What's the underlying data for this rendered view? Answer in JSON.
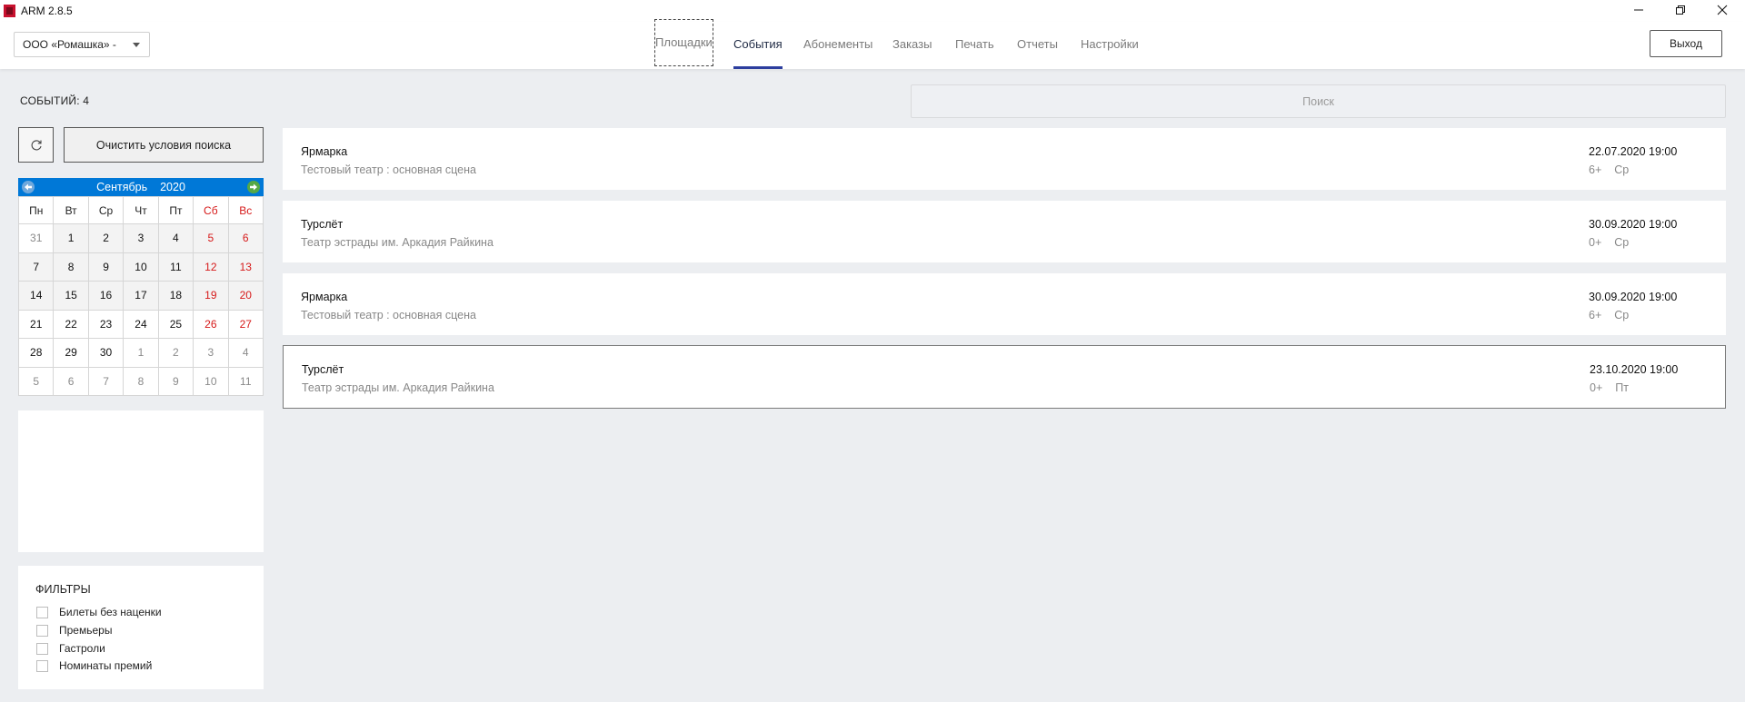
{
  "window": {
    "title": "ARM 2.8.5"
  },
  "header": {
    "organization": "ООО «Ромашка» -",
    "tabs": [
      {
        "label": "Площадки"
      },
      {
        "label": "События"
      },
      {
        "label": "Абонементы"
      },
      {
        "label": "Заказы"
      },
      {
        "label": "Печать"
      },
      {
        "label": "Отчеты"
      },
      {
        "label": "Настройки"
      }
    ],
    "active_tab": "События",
    "logout_label": "Выход"
  },
  "events_count": {
    "label": "СОБЫТИЙ:",
    "value": "4"
  },
  "search": {
    "placeholder": "Поиск"
  },
  "controls": {
    "clear_label": "Очистить условия поиска"
  },
  "calendar": {
    "month": "Сентябрь",
    "year": "2020",
    "weekdays": [
      "Пн",
      "Вт",
      "Ср",
      "Чт",
      "Пт",
      "Сб",
      "Вс"
    ],
    "weeks": [
      [
        "31",
        "1",
        "2",
        "3",
        "4",
        "5",
        "6"
      ],
      [
        "7",
        "8",
        "9",
        "10",
        "11",
        "12",
        "13"
      ],
      [
        "14",
        "15",
        "16",
        "17",
        "18",
        "19",
        "20"
      ],
      [
        "21",
        "22",
        "23",
        "24",
        "25",
        "26",
        "27"
      ],
      [
        "28",
        "29",
        "30",
        "1",
        "2",
        "3",
        "4"
      ],
      [
        "5",
        "6",
        "7",
        "8",
        "9",
        "10",
        "11"
      ]
    ]
  },
  "filters": {
    "title": "ФИЛЬТРЫ",
    "items": [
      {
        "label": "Билеты без наценки",
        "checked": false
      },
      {
        "label": "Премьеры",
        "checked": false
      },
      {
        "label": "Гастроли",
        "checked": false
      },
      {
        "label": "Номинаты премий",
        "checked": false
      }
    ]
  },
  "events": [
    {
      "title": "Ярмарка",
      "venue": "Тестовый театр : основная сцена",
      "datetime": "22.07.2020 19:00",
      "age": "6+",
      "weekday": "Ср"
    },
    {
      "title": "Турслёт",
      "venue": "Театр эстрады им. Аркадия Райкина",
      "datetime": "30.09.2020 19:00",
      "age": "0+",
      "weekday": "Ср"
    },
    {
      "title": "Ярмарка",
      "venue": "Тестовый театр : основная сцена",
      "datetime": "30.09.2020 19:00",
      "age": "6+",
      "weekday": "Ср"
    },
    {
      "title": "Турслёт",
      "venue": "Театр эстрады им. Аркадия Райкина",
      "datetime": "23.10.2020 19:00",
      "age": "0+",
      "weekday": "Пт"
    }
  ],
  "colors": {
    "accent": "#2c3e9e",
    "calendar_header": "#0078d7",
    "weekend": "#d61a1a",
    "background": "#eceef1"
  }
}
